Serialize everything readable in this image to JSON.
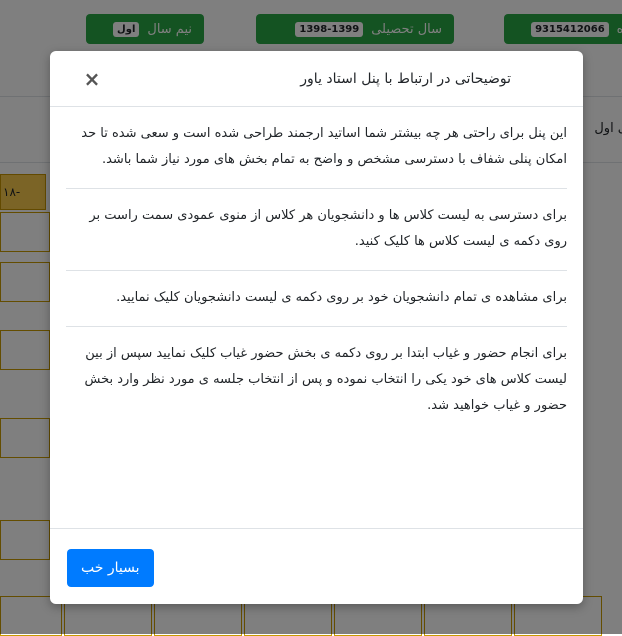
{
  "header": {
    "semester_label": "نیم سال",
    "semester_value": "اول",
    "year_label": "سال تحصیلی",
    "year_value": "1398-1399",
    "id_value": "9315412066",
    "id_suffix": ": ه"
  },
  "background": {
    "side_text": "ی اول",
    "yellow_cell": "۱۸-"
  },
  "modal": {
    "title": "توضیحاتی در ارتباط با پنل استاد یاور",
    "close_symbol": "×",
    "paragraphs": [
      "این پنل برای راحتی هر چه بیشتر شما اساتید ارجمند طراحی شده است و سعی شده تا حد امکان پنلی شفاف با دسترسی مشخص و واضح به تمام بخش های مورد نیاز شما باشد.",
      "برای دسترسی به لیست کلاس ها و دانشجویان هر کلاس از منوی عمودی سمت راست بر روی دکمه ی لیست کلاس ها کلیک کنید.",
      "برای مشاهده ی تمام دانشجویان خود بر روی دکمه ی لیست دانشجویان کلیک نمایید.",
      "برای انجام حضور و غیاب ابتدا بر روی دکمه ی بخش حضور غیاب کلیک نمایید سپس از بین لیست کلاس های خود یکی را انتخاب نموده و پس از انتخاب جلسه ی مورد نظر وارد بخش حضور و غیاب خواهید شد."
    ],
    "ok_button": "بسیار خب"
  },
  "colors": {
    "pill_green": "#28a745",
    "button_blue": "#007bff",
    "yellow": "#f6c84c",
    "overlay": "rgba(0,0,0,0.5)"
  }
}
